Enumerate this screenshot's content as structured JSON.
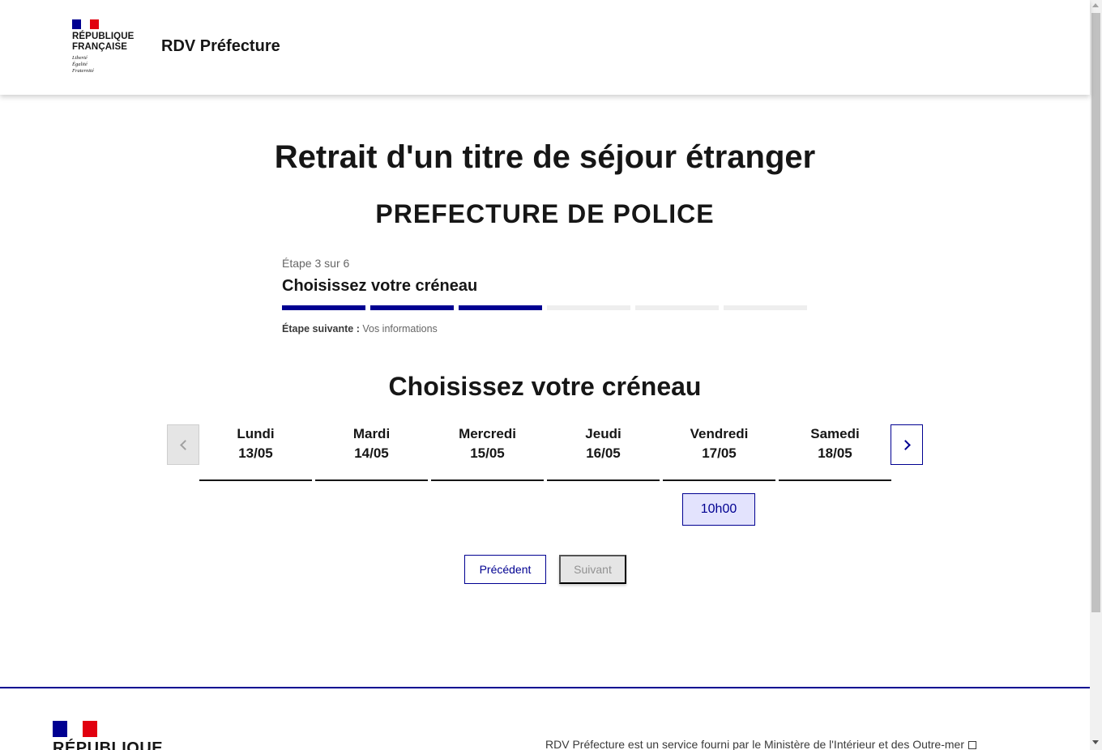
{
  "header": {
    "logo_title_line1": "RÉPUBLIQUE",
    "logo_title_line2": "FRANÇAISE",
    "motto_1": "Liberté",
    "motto_2": "Égalité",
    "motto_3": "Fraternité",
    "site_name": "RDV Préfecture"
  },
  "main": {
    "title": "Retrait d'un titre de séjour étranger",
    "prefecture": "PREFECTURE DE POLICE",
    "stepper": {
      "state": "Étape 3 sur 6",
      "title": "Choisissez votre créneau",
      "current_step": 3,
      "total_steps": 6,
      "next_label": "Étape suivante :",
      "next_value": "Vos informations"
    },
    "section_title": "Choisissez votre créneau",
    "days": [
      {
        "name": "Lundi",
        "date": "13/05"
      },
      {
        "name": "Mardi",
        "date": "14/05"
      },
      {
        "name": "Mercredi",
        "date": "15/05"
      },
      {
        "name": "Jeudi",
        "date": "16/05"
      },
      {
        "name": "Vendredi",
        "date": "17/05"
      },
      {
        "name": "Samedi",
        "date": "18/05"
      }
    ],
    "slot": {
      "day": "Vendredi",
      "time": "10h00"
    },
    "buttons": {
      "previous": "Précédent",
      "next": "Suivant"
    }
  },
  "footer": {
    "brand": "RÉPUBLIQUE",
    "description": "RDV Préfecture est un service fourni par le Ministère de l'Intérieur et des Outre-mer"
  },
  "colors": {
    "primary": "#000091",
    "slot_bg": "#e3e3fd",
    "flag_red": "#e1000f",
    "disabled_bg": "#e5e5e5"
  },
  "icons": {
    "prev": "chevron-left-icon",
    "next": "chevron-right-icon",
    "external": "external-link-icon"
  }
}
